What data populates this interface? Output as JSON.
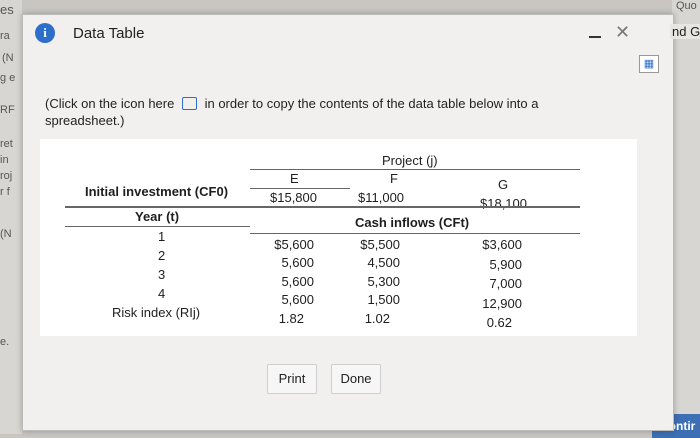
{
  "background": {
    "left_fragments": [
      "es",
      "ra",
      "(N",
      "g e",
      "RF",
      "ret",
      "in",
      "roj",
      "r f",
      "(N",
      "e."
    ],
    "right_top": "Quo",
    "right_fragment": "nd G. The",
    "continue_label": "Contir"
  },
  "dialog": {
    "title": "Data Table",
    "instruction_before": "(Click on the icon here",
    "instruction_after": "in order to copy the contents of the data table below into a spreadsheet.)",
    "accent": "#2d6ecb"
  },
  "table": {
    "project_header": "Project (j)",
    "columns": [
      "E",
      "F",
      "G"
    ],
    "initial_investment_label": "Initial investment (CF0)",
    "initial_investment": [
      "$15,800",
      "$11,000",
      "$18,100"
    ],
    "year_label": "Year (t)",
    "cash_inflows_label": "Cash inflows (CFt)",
    "rows": [
      {
        "year": "1",
        "values": [
          "$5,600",
          "$5,500",
          "$3,600"
        ]
      },
      {
        "year": "2",
        "values": [
          "5,600",
          "4,500",
          "5,900"
        ]
      },
      {
        "year": "3",
        "values": [
          "5,600",
          "5,300",
          "7,000"
        ]
      },
      {
        "year": "4",
        "values": [
          "5,600",
          "1,500",
          "12,900"
        ]
      }
    ],
    "risk_label": "Risk index (RIj)",
    "risk_values": [
      "1.82",
      "1.02",
      "0.62"
    ]
  },
  "buttons": {
    "print": "Print",
    "done": "Done"
  }
}
